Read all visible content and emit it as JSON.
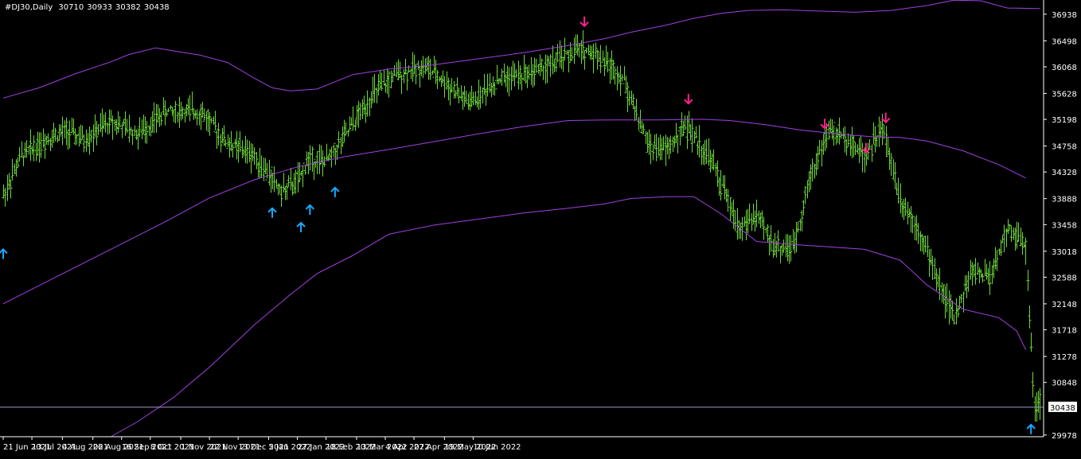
{
  "header": {
    "symbol": "#DJ30,Daily",
    "open": "30710",
    "high": "30933",
    "low": "30382",
    "close": "30438"
  },
  "colors": {
    "background": "#000000",
    "bars": "#6fd93a",
    "bands": "#a040e0",
    "arrow_up": "#18a8ff",
    "arrow_down": "#ff1f8f",
    "axis": "#ffffff",
    "price_line": "#9a9ac8"
  },
  "chart_data": {
    "type": "bar",
    "title": "#DJ30,Daily",
    "ohlc_last": {
      "open": 30710,
      "high": 30933,
      "low": 30382,
      "close": 30438
    },
    "y_ticks": [
      36938,
      36498,
      36068,
      35628,
      35198,
      34758,
      34328,
      33888,
      33458,
      33018,
      32588,
      32148,
      31718,
      31278,
      30848,
      30438,
      29978
    ],
    "x_ticks": [
      "21 Jun 2021",
      "13 Jul 2021",
      "4 Aug 2021",
      "26 Aug 2021",
      "16 Sep 2021",
      "8 Oct 2021",
      "1 Nov 2021",
      "22 Nov 2021",
      "13 Dec 2021",
      "5 Jan 2022",
      "27 Jan 2022",
      "18 Feb 2022",
      "13 Mar 2022",
      "4 Apr 2022",
      "27 Apr 2022",
      "19 May 2022",
      "10 Jun 2022"
    ],
    "current_price": 30438,
    "ylim": [
      29950,
      37120
    ],
    "grid": false,
    "bands": {
      "upper": [
        [
          0,
          35550
        ],
        [
          20,
          35720
        ],
        [
          40,
          35950
        ],
        [
          60,
          36150
        ],
        [
          70,
          36270
        ],
        [
          85,
          36380
        ],
        [
          95,
          36330
        ],
        [
          110,
          36260
        ],
        [
          125,
          36140
        ],
        [
          140,
          35880
        ],
        [
          150,
          35720
        ],
        [
          160,
          35670
        ],
        [
          175,
          35700
        ],
        [
          195,
          35940
        ],
        [
          215,
          36030
        ],
        [
          240,
          36100
        ],
        [
          265,
          36200
        ],
        [
          290,
          36300
        ],
        [
          315,
          36420
        ],
        [
          335,
          36530
        ],
        [
          350,
          36640
        ],
        [
          370,
          36760
        ],
        [
          385,
          36870
        ],
        [
          400,
          36950
        ],
        [
          415,
          37000
        ],
        [
          435,
          37010
        ],
        [
          455,
          36990
        ],
        [
          475,
          36970
        ],
        [
          495,
          37000
        ],
        [
          515,
          37080
        ],
        [
          530,
          37170
        ],
        [
          545,
          37160
        ],
        [
          560,
          37040
        ],
        [
          578,
          37030
        ]
      ],
      "middle": [
        [
          0,
          32150
        ],
        [
          30,
          32600
        ],
        [
          60,
          33050
        ],
        [
          90,
          33500
        ],
        [
          115,
          33900
        ],
        [
          140,
          34200
        ],
        [
          165,
          34420
        ],
        [
          190,
          34580
        ],
        [
          215,
          34700
        ],
        [
          240,
          34830
        ],
        [
          265,
          34960
        ],
        [
          290,
          35080
        ],
        [
          315,
          35180
        ],
        [
          340,
          35190
        ],
        [
          365,
          35190
        ],
        [
          390,
          35200
        ],
        [
          405,
          35180
        ],
        [
          425,
          35110
        ],
        [
          445,
          35020
        ],
        [
          465,
          34960
        ],
        [
          485,
          34910
        ],
        [
          500,
          34900
        ],
        [
          515,
          34840
        ],
        [
          535,
          34680
        ],
        [
          555,
          34450
        ],
        [
          570,
          34230
        ]
      ],
      "lower": [
        [
          60,
          29950
        ],
        [
          75,
          30200
        ],
        [
          95,
          30600
        ],
        [
          115,
          31100
        ],
        [
          140,
          31800
        ],
        [
          160,
          32300
        ],
        [
          175,
          32650
        ],
        [
          195,
          32950
        ],
        [
          215,
          33300
        ],
        [
          240,
          33450
        ],
        [
          265,
          33550
        ],
        [
          290,
          33650
        ],
        [
          315,
          33730
        ],
        [
          335,
          33800
        ],
        [
          350,
          33890
        ],
        [
          370,
          33920
        ],
        [
          385,
          33920
        ],
        [
          400,
          33640
        ],
        [
          420,
          33180
        ],
        [
          440,
          33130
        ],
        [
          460,
          33090
        ],
        [
          480,
          33050
        ],
        [
          500,
          32870
        ],
        [
          515,
          32460
        ],
        [
          535,
          32060
        ],
        [
          555,
          31920
        ],
        [
          565,
          31700
        ],
        [
          570,
          31390
        ]
      ]
    },
    "signals_up": [
      [
        0,
        32970
      ],
      [
        150,
        33650
      ],
      [
        166,
        33410
      ],
      [
        171,
        33700
      ],
      [
        185,
        33990
      ],
      [
        573,
        30070
      ]
    ],
    "signals_down": [
      [
        324,
        36820
      ],
      [
        382,
        35540
      ],
      [
        458,
        35130
      ],
      [
        481,
        34730
      ],
      [
        492,
        35230
      ]
    ]
  }
}
